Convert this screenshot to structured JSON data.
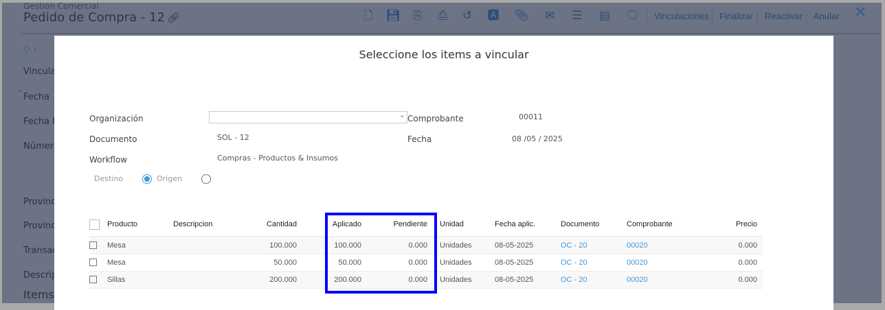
{
  "header": {
    "module": "Gestión Comercial",
    "title": "Pedido de Compra - 12"
  },
  "toolbar": {
    "icons": [
      "new-document-icon",
      "save-icon",
      "copy-icon",
      "print-icon",
      "history-icon",
      "text-document-icon",
      "attachment-icon",
      "email-icon",
      "checklist-icon",
      "report-icon",
      "comment-icon"
    ],
    "buttons": [
      "Vinculaciones",
      "Finalizar",
      "Reactivar",
      "Anular"
    ]
  },
  "background_form": {
    "labels": [
      "Vinculac",
      "Fecha",
      "Fecha E",
      "Númerc",
      "Provinc",
      "Provinc",
      "Transac",
      "Descrip"
    ],
    "section": "Items"
  },
  "modal": {
    "title": "Seleccione los items a vincular",
    "organizacion_label": "Organización",
    "organizacion_value": "",
    "comprobante_label": "Comprobante",
    "comprobante_value": "00011",
    "documento_label": "Documento",
    "documento_value": "SOL - 12",
    "fecha_label": "Fecha",
    "fecha_value": "08 /05 / 2025",
    "workflow_label": "Workflow",
    "workflow_value": "Compras - Productos & Insumos",
    "destino_label": "Destino",
    "origen_label": "Origen",
    "columns": [
      "Producto",
      "Descripcion",
      "Cantidad",
      "Aplicado",
      "Pendiente",
      "Unidad",
      "Fecha aplic.",
      "Documento",
      "Comprobante",
      "Precio"
    ],
    "rows": [
      {
        "producto": "Mesa",
        "descripcion": "",
        "cantidad": "100.000",
        "aplicado": "100.000",
        "pendiente": "0.000",
        "unidad": "Unidades",
        "fecha": "08-05-2025",
        "documento": "OC - 20",
        "comprobante": "00020",
        "precio": "0.000"
      },
      {
        "producto": "Mesa",
        "descripcion": "",
        "cantidad": "50.000",
        "aplicado": "50.000",
        "pendiente": "0.000",
        "unidad": "Unidades",
        "fecha": "08-05-2025",
        "documento": "OC - 20",
        "comprobante": "00020",
        "precio": "0.000"
      },
      {
        "producto": "Sillas",
        "descripcion": "",
        "cantidad": "200.000",
        "aplicado": "200.000",
        "pendiente": "0.000",
        "unidad": "Unidades",
        "fecha": "08-05-2025",
        "documento": "OC - 20",
        "comprobante": "00020",
        "precio": "0.000"
      }
    ]
  }
}
